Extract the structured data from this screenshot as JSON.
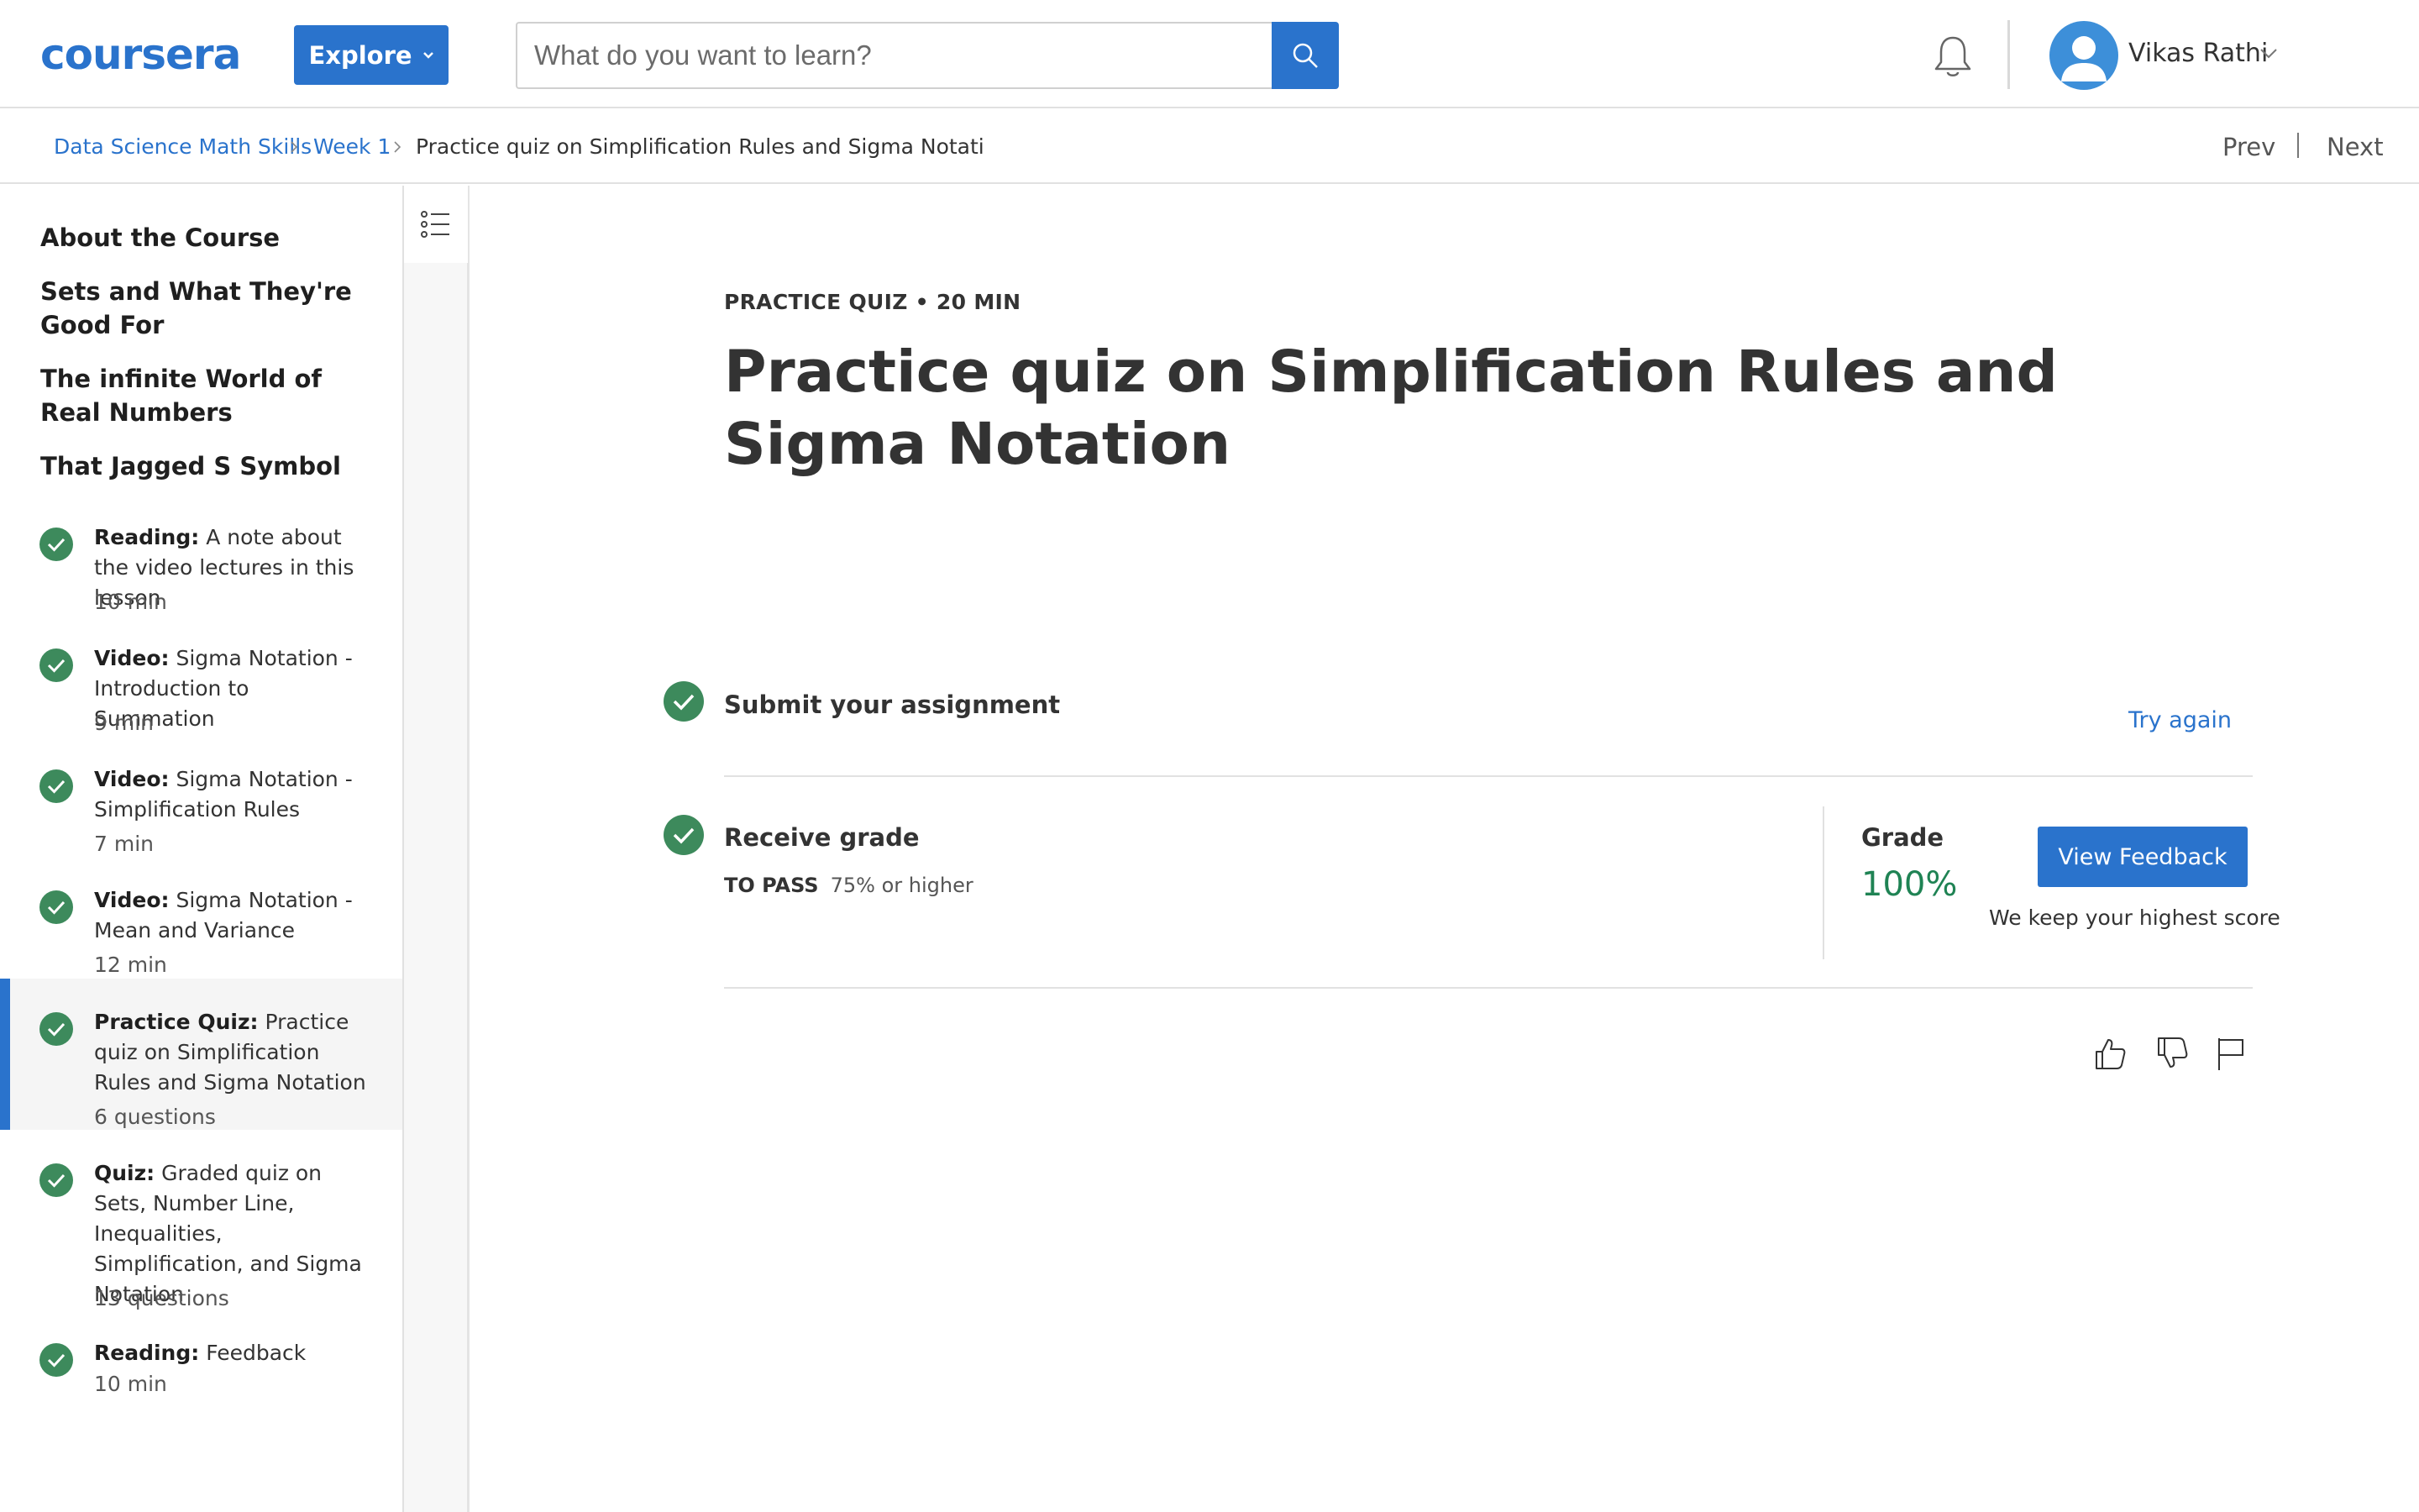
{
  "header": {
    "logo_text": "coursera",
    "explore_label": "Explore",
    "search_placeholder": "What do you want to learn?",
    "user_name": "Vikas Rathi"
  },
  "breadcrumb": {
    "items": [
      "Data Science Math Skills",
      "Week 1"
    ],
    "current": "Practice quiz on Simplification Rules and Sigma Notati"
  },
  "nav": {
    "prev": "Prev",
    "next": "Next"
  },
  "sidebar": {
    "sections": [
      "About the Course",
      "Sets and What They're Good For",
      "The infinite World of Real Numbers",
      "That Jagged S Symbol"
    ],
    "items": [
      {
        "type": "Reading:",
        "title": "A note about the video lectures in this lesson",
        "meta": "10 min"
      },
      {
        "type": "Video:",
        "title": "Sigma Notation - Introduction to Summation",
        "meta": "9 min"
      },
      {
        "type": "Video:",
        "title": "Sigma Notation - Simplification Rules",
        "meta": "7 min"
      },
      {
        "type": "Video:",
        "title": "Sigma Notation - Mean and Variance",
        "meta": "12 min"
      },
      {
        "type": "Practice Quiz:",
        "title": "Practice quiz on Simplification Rules and Sigma Notation",
        "meta": "6 questions"
      },
      {
        "type": "Quiz:",
        "title": "Graded quiz on Sets, Number Line, Inequalities, Simplification, and Sigma Notation",
        "meta": "13 questions"
      },
      {
        "type": "Reading:",
        "title": "Feedback",
        "meta": "10 min"
      }
    ]
  },
  "main": {
    "kicker": "PRACTICE QUIZ • 20 MIN",
    "title": "Practice quiz on Simplification Rules and Sigma Notation",
    "submit_label": "Submit your assignment",
    "try_again": "Try again",
    "receive_label": "Receive grade",
    "to_pass_label": "TO PASS",
    "to_pass_value": "75% or higher",
    "grade_label": "Grade",
    "grade_value": "100%",
    "view_feedback": "View Feedback",
    "highest_note": "We keep your highest score"
  },
  "colors": {
    "brand_blue": "#2a73cc",
    "success_green": "#1f8354",
    "check_green": "#3d8a5c"
  },
  "icons": [
    "search-icon",
    "bell-icon",
    "avatar-icon",
    "list-icon",
    "check-icon",
    "thumbs-up-icon",
    "thumbs-down-icon",
    "flag-icon"
  ]
}
